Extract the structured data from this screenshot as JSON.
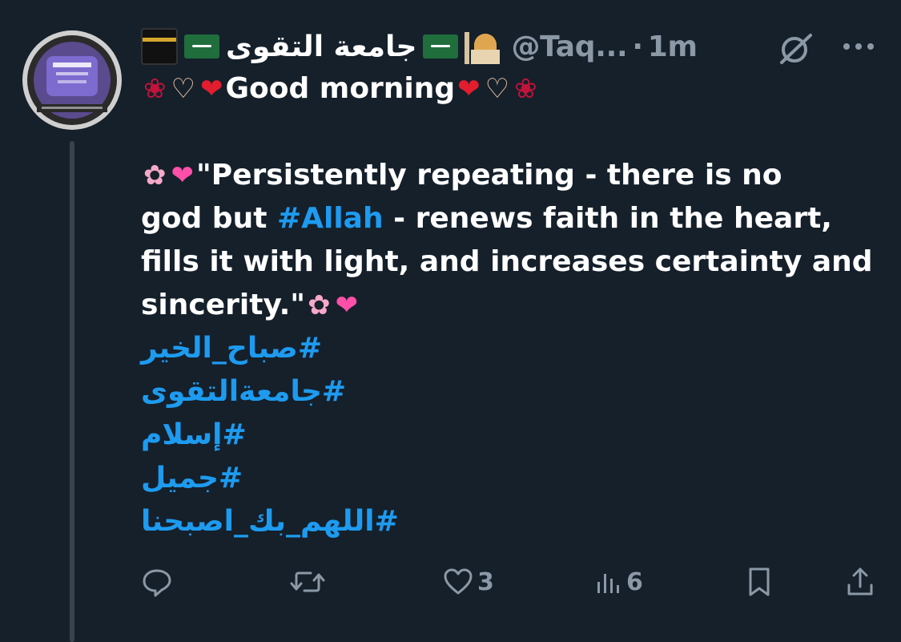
{
  "colors": {
    "background": "#15202b",
    "text": "#ffffff",
    "secondary": "#8b98a5",
    "link": "#1d9bf0",
    "thread_line": "#38444d"
  },
  "header": {
    "display_name": "جامعة التقوى",
    "handle": "@Taq...",
    "separator": "·",
    "time": "1m",
    "name_icons": [
      "kaaba-icon",
      "saudi-flag-icon",
      "saudi-flag-icon",
      "mosque-icon"
    ]
  },
  "post": {
    "greeting": "Good morning",
    "quote_part1": "\"Persistently repeating - there is no",
    "quote_part2_pre": "god but ",
    "quote_hashtag": "#Allah",
    "quote_part2_post": " - renews faith in the heart,",
    "quote_part3": "fills it with light, and increases certainty and",
    "quote_part4": "sincerity.\"",
    "hashtags": [
      "#صباح_الخير",
      "#جامعةالتقوى",
      "#إسلام",
      "#جميل",
      "#اللهم_بك_اصبحنا"
    ]
  },
  "actions": {
    "reply_count": "",
    "repost_count": "",
    "like_count": "3",
    "views_count": "6"
  }
}
